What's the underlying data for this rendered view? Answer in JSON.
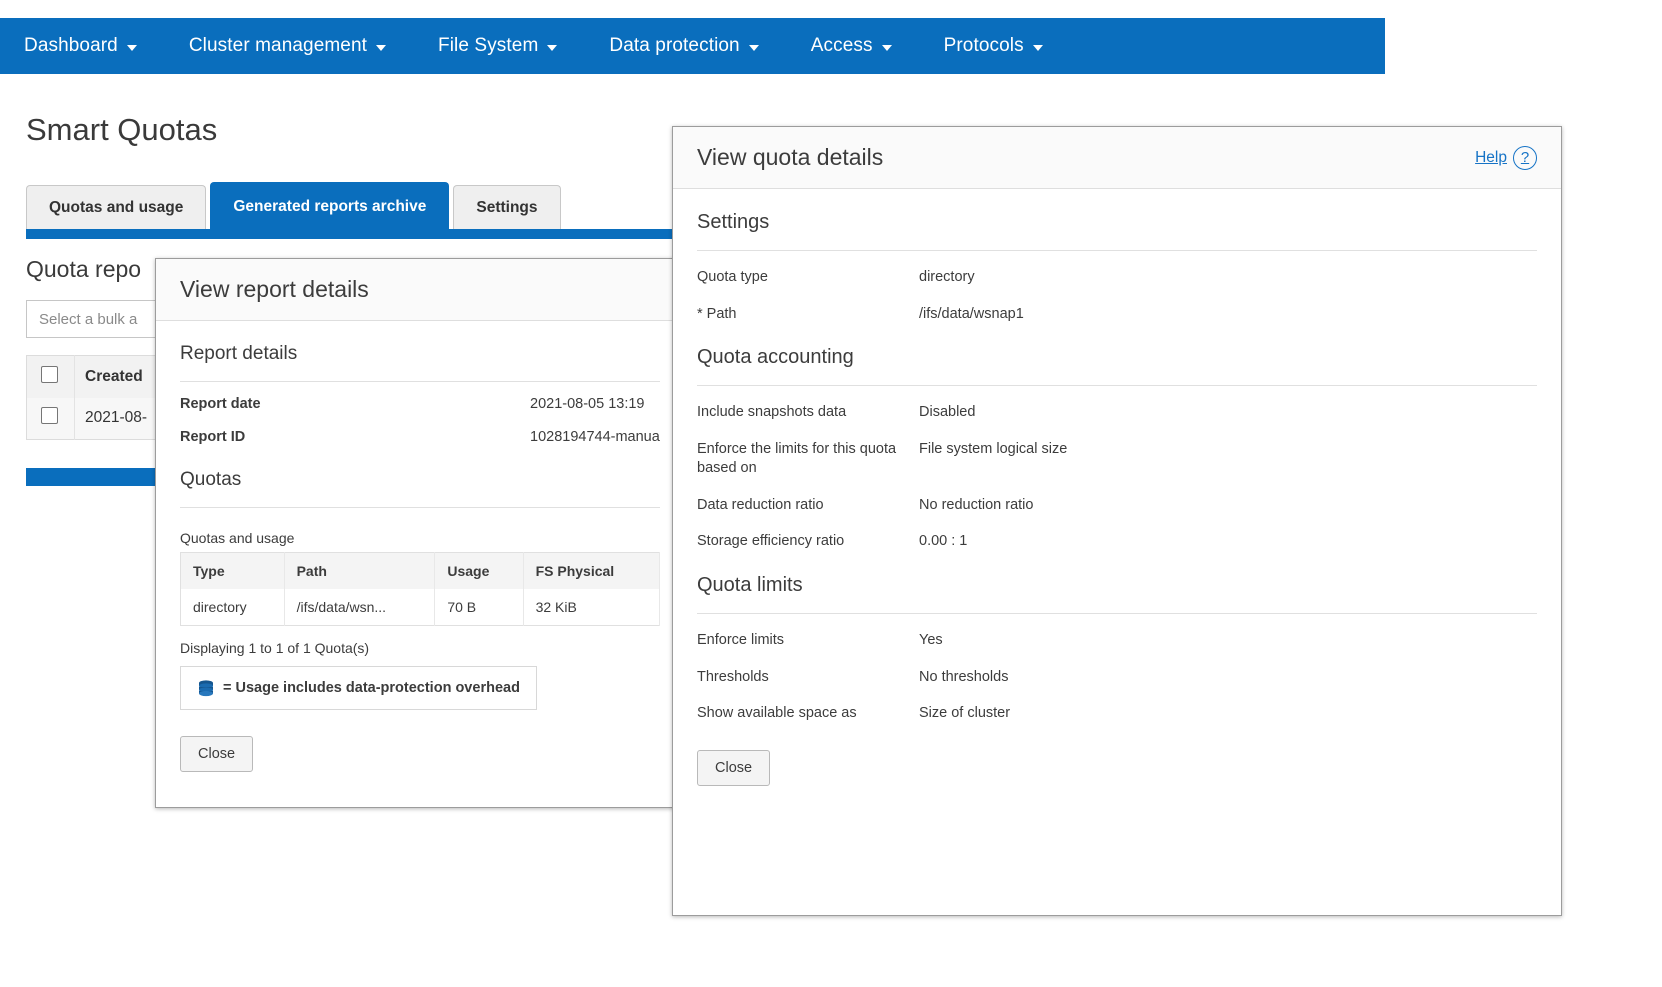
{
  "nav": {
    "items": [
      {
        "label": "Dashboard",
        "caret": "chevron-down-icon"
      },
      {
        "label": "Cluster management",
        "caret": "chevron-down-icon"
      },
      {
        "label": "File System",
        "caret": "chevron-down-icon"
      },
      {
        "label": "Data protection",
        "caret": "chevron-down-icon"
      },
      {
        "label": "Access",
        "caret": "chevron-down-icon"
      },
      {
        "label": "Protocols",
        "caret": "chevron-down-icon"
      }
    ]
  },
  "page": {
    "title": "Smart Quotas",
    "tabs": [
      {
        "label": "Quotas and usage",
        "active": false
      },
      {
        "label": "Generated reports archive",
        "active": true
      },
      {
        "label": "Settings",
        "active": false
      }
    ],
    "section_title": "Quota repo",
    "bulk_action_placeholder": "Select a bulk a",
    "table": {
      "columns": [
        "Created"
      ],
      "rows": [
        [
          "2021-08-"
        ]
      ]
    }
  },
  "report_modal": {
    "title": "View report details",
    "group_details": "Report details",
    "fields": [
      {
        "label": "Report date",
        "value": "2021-08-05 13:19"
      },
      {
        "label": "Report ID",
        "value": "1028194744-manua"
      }
    ],
    "group_quotas": "Quotas",
    "table_label": "Quotas and usage",
    "table": {
      "columns": [
        "Type",
        "Path",
        "Usage",
        "FS Physical"
      ],
      "rows": [
        [
          "directory",
          "/ifs/data/wsn...",
          "70 B",
          "32 KiB"
        ]
      ]
    },
    "displaying": "Displaying 1 to 1 of 1 Quota(s)",
    "legend_icon": "disk-stack-icon",
    "legend": "= Usage includes data-protection overhead",
    "close_label": "Close"
  },
  "quota_modal": {
    "title": "View quota details",
    "help_label": "Help",
    "help_icon": "question-circle-icon",
    "sections": [
      {
        "heading": "Settings",
        "fields": [
          {
            "label": "Quota type",
            "value": "directory"
          },
          {
            "label": "* Path",
            "value": "/ifs/data/wsnap1"
          }
        ]
      },
      {
        "heading": "Quota accounting",
        "fields": [
          {
            "label": "Include snapshots data",
            "value": "Disabled"
          },
          {
            "label": "Enforce the limits for this quota based on",
            "value": "File system logical size"
          },
          {
            "label": "Data reduction ratio",
            "value": "No reduction ratio"
          },
          {
            "label": "Storage efficiency ratio",
            "value": "0.00 : 1"
          }
        ]
      },
      {
        "heading": "Quota limits",
        "fields": [
          {
            "label": "Enforce limits",
            "value": "Yes"
          },
          {
            "label": "Thresholds",
            "value": "No thresholds"
          },
          {
            "label": "Show available space as",
            "value": "Size of cluster"
          }
        ]
      }
    ],
    "close_label": "Close"
  },
  "colors": {
    "brand_blue": "#0a6ebd",
    "link_blue": "#1573c6",
    "text": "#3c3c3c"
  }
}
